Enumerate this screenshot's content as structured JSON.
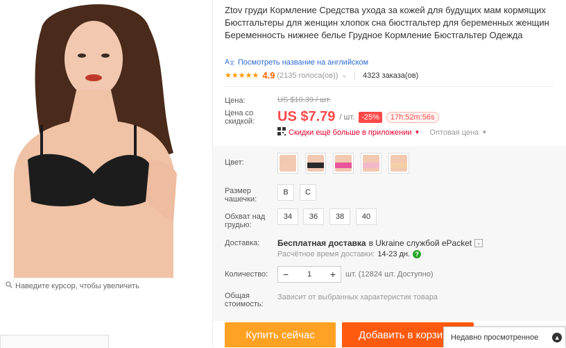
{
  "product": {
    "title": "Ztov груди Кормление Средства ухода за кожей для будущих мам кормящих Бюстгальтеры для женщин хлопок сна бюстгальтер для беременных женщин Беременность нижнее белье Грудное Кормление Бюстгальтер Одежда",
    "translate_link": "Посмотреть название на английском",
    "translate_icon": "translate-icon",
    "zoom_hint": "Наведите курсор, чтобы увеличить"
  },
  "rating": {
    "stars": "★★★★★",
    "value": "4.9",
    "votes": "(2135 голоса(ов))",
    "orders": "4323 заказа(ов)"
  },
  "price": {
    "label_price": "Цена:",
    "old_price": "US $10.39 / шт.",
    "label_discount_price": "Цена со скидкой:",
    "current": "US $7.79",
    "per_unit": "/ шт.",
    "discount": "-25%",
    "timer": "17h:52m:56s",
    "app_deal": "Скидки ещё больше в приложении",
    "wholesale": "Оптовая цена"
  },
  "options": {
    "color_label": "Цвет:",
    "colors": [
      "#f3c9b3",
      "#2b2b2b",
      "#e8559a",
      "#f0b8c8",
      "#f5cfa8"
    ],
    "cup_label": "Размер чашечки:",
    "cups": [
      "B",
      "C"
    ],
    "bust_label": "Обхват над грудью:",
    "busts": [
      "34",
      "36",
      "38",
      "40"
    ]
  },
  "shipping": {
    "label": "Доставка:",
    "free_prefix": "Бесплатная доставка",
    "free_rest": "в Ukraine службой ePacket",
    "time_label": "Расчётное время доставки:",
    "time_value": "14-23 дн."
  },
  "quantity": {
    "label": "Количество:",
    "value": "1",
    "minus": "−",
    "plus": "+",
    "available": "шт. (12824 шт. Доступно)"
  },
  "total": {
    "label": "Общая стоимость:",
    "text": "Зависит от выбранных характеристик товара"
  },
  "actions": {
    "buy": "Купить сейчас",
    "cart": "Добавить в корзину"
  },
  "recent": {
    "label": "Недавно просмотренное",
    "icon": "chevron-up-icon"
  }
}
